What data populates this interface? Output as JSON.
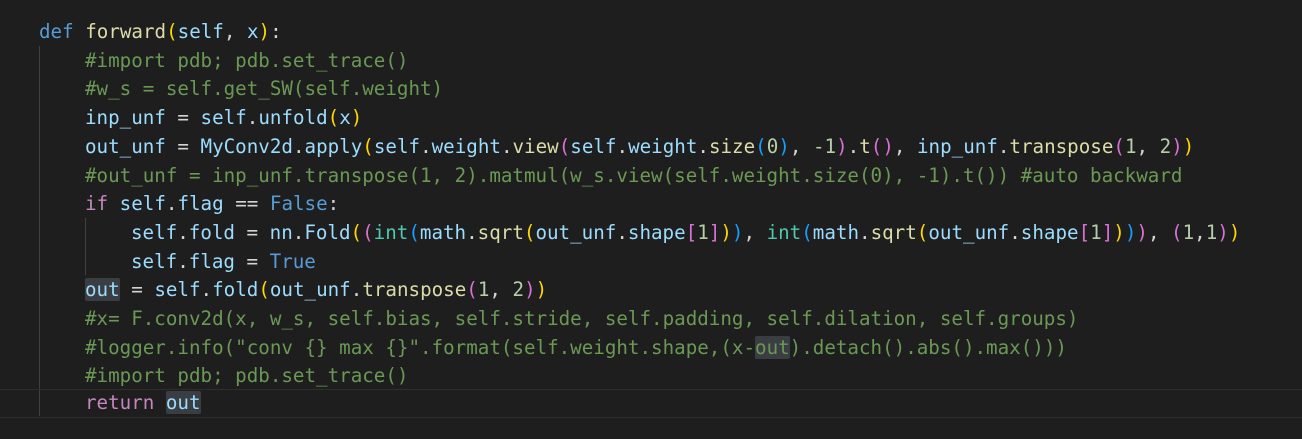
{
  "editor": {
    "language": "python",
    "lines": [
      [
        {
          "t": "def",
          "c": "kw"
        },
        {
          "t": " "
        },
        {
          "t": "forward",
          "c": "fn"
        },
        {
          "t": "(",
          "c": "b1"
        },
        {
          "t": "self",
          "c": "var"
        },
        {
          "t": ", "
        },
        {
          "t": "x",
          "c": "var"
        },
        {
          "t": ")",
          "c": "b1"
        },
        {
          "t": ":"
        }
      ],
      [
        {
          "t": "#import pdb; pdb.set_trace()",
          "c": "cmt"
        }
      ],
      [
        {
          "t": "#w_s = self.get_SW(self.weight)",
          "c": "cmt"
        }
      ],
      [
        {
          "t": "inp_unf",
          "c": "var"
        },
        {
          "t": " = "
        },
        {
          "t": "self",
          "c": "var"
        },
        {
          "t": "."
        },
        {
          "t": "unfold",
          "c": "var"
        },
        {
          "t": "(",
          "c": "b1"
        },
        {
          "t": "x",
          "c": "var"
        },
        {
          "t": ")",
          "c": "b1"
        }
      ],
      [
        {
          "t": "out_unf",
          "c": "var"
        },
        {
          "t": " = "
        },
        {
          "t": "MyConv2d",
          "c": "var"
        },
        {
          "t": "."
        },
        {
          "t": "apply",
          "c": "var"
        },
        {
          "t": "(",
          "c": "b1"
        },
        {
          "t": "self",
          "c": "var"
        },
        {
          "t": "."
        },
        {
          "t": "weight",
          "c": "var"
        },
        {
          "t": "."
        },
        {
          "t": "view",
          "c": "fn"
        },
        {
          "t": "(",
          "c": "b2"
        },
        {
          "t": "self",
          "c": "var"
        },
        {
          "t": "."
        },
        {
          "t": "weight",
          "c": "var"
        },
        {
          "t": "."
        },
        {
          "t": "size",
          "c": "fn"
        },
        {
          "t": "(",
          "c": "b3"
        },
        {
          "t": "0",
          "c": "num"
        },
        {
          "t": ")",
          "c": "b3"
        },
        {
          "t": ", "
        },
        {
          "t": "-1",
          "c": "num"
        },
        {
          "t": ")",
          "c": "b2"
        },
        {
          "t": "."
        },
        {
          "t": "t",
          "c": "fn"
        },
        {
          "t": "(",
          "c": "b2"
        },
        {
          "t": ")",
          "c": "b2"
        },
        {
          "t": ", "
        },
        {
          "t": "inp_unf",
          "c": "var"
        },
        {
          "t": "."
        },
        {
          "t": "transpose",
          "c": "fn"
        },
        {
          "t": "(",
          "c": "b2"
        },
        {
          "t": "1",
          "c": "num"
        },
        {
          "t": ", "
        },
        {
          "t": "2",
          "c": "num"
        },
        {
          "t": ")",
          "c": "b2"
        },
        {
          "t": ")",
          "c": "b1"
        }
      ],
      [
        {
          "t": "#out_unf = inp_unf.transpose(1, 2).matmul(w_s.view(self.weight.size(0), -1).t()) #auto backward",
          "c": "cmt"
        }
      ],
      [
        {
          "t": "if",
          "c": "ctl"
        },
        {
          "t": " "
        },
        {
          "t": "self",
          "c": "var"
        },
        {
          "t": "."
        },
        {
          "t": "flag",
          "c": "var"
        },
        {
          "t": " == "
        },
        {
          "t": "False",
          "c": "kw"
        },
        {
          "t": ":"
        }
      ],
      [
        {
          "t": "self",
          "c": "var"
        },
        {
          "t": "."
        },
        {
          "t": "fold",
          "c": "var"
        },
        {
          "t": " = "
        },
        {
          "t": "nn",
          "c": "var"
        },
        {
          "t": "."
        },
        {
          "t": "Fold",
          "c": "var"
        },
        {
          "t": "(",
          "c": "b1"
        },
        {
          "t": "(",
          "c": "b2"
        },
        {
          "t": "int",
          "c": "cls"
        },
        {
          "t": "(",
          "c": "b3"
        },
        {
          "t": "math",
          "c": "var"
        },
        {
          "t": "."
        },
        {
          "t": "sqrt",
          "c": "fn"
        },
        {
          "t": "(",
          "c": "b1"
        },
        {
          "t": "out_unf",
          "c": "var"
        },
        {
          "t": "."
        },
        {
          "t": "shape",
          "c": "var"
        },
        {
          "t": "[",
          "c": "b2"
        },
        {
          "t": "1",
          "c": "num"
        },
        {
          "t": "]",
          "c": "b2"
        },
        {
          "t": ")",
          "c": "b1"
        },
        {
          "t": ")",
          "c": "b3"
        },
        {
          "t": ", "
        },
        {
          "t": "int",
          "c": "cls"
        },
        {
          "t": "(",
          "c": "b3"
        },
        {
          "t": "math",
          "c": "var"
        },
        {
          "t": "."
        },
        {
          "t": "sqrt",
          "c": "fn"
        },
        {
          "t": "(",
          "c": "b1"
        },
        {
          "t": "out_unf",
          "c": "var"
        },
        {
          "t": "."
        },
        {
          "t": "shape",
          "c": "var"
        },
        {
          "t": "[",
          "c": "b2"
        },
        {
          "t": "1",
          "c": "num"
        },
        {
          "t": "]",
          "c": "b2"
        },
        {
          "t": ")",
          "c": "b1"
        },
        {
          "t": ")",
          "c": "b3"
        },
        {
          "t": ")",
          "c": "b2"
        },
        {
          "t": ", "
        },
        {
          "t": "(",
          "c": "b2"
        },
        {
          "t": "1",
          "c": "num"
        },
        {
          "t": ","
        },
        {
          "t": "1",
          "c": "num"
        },
        {
          "t": ")",
          "c": "b2"
        },
        {
          "t": ")",
          "c": "b1"
        }
      ],
      [
        {
          "t": "self",
          "c": "var"
        },
        {
          "t": "."
        },
        {
          "t": "flag",
          "c": "var"
        },
        {
          "t": " = "
        },
        {
          "t": "True",
          "c": "kw"
        }
      ],
      [
        {
          "t": "out",
          "c": "var",
          "hl": true
        },
        {
          "t": " = "
        },
        {
          "t": "self",
          "c": "var"
        },
        {
          "t": "."
        },
        {
          "t": "fold",
          "c": "var"
        },
        {
          "t": "(",
          "c": "b1"
        },
        {
          "t": "out_unf",
          "c": "var"
        },
        {
          "t": "."
        },
        {
          "t": "transpose",
          "c": "fn"
        },
        {
          "t": "(",
          "c": "b2"
        },
        {
          "t": "1",
          "c": "num"
        },
        {
          "t": ", "
        },
        {
          "t": "2",
          "c": "num"
        },
        {
          "t": ")",
          "c": "b2"
        },
        {
          "t": ")",
          "c": "b1"
        }
      ],
      [
        {
          "t": "#x= F.conv2d(x, w_s, self.bias, self.stride, self.padding, self.dilation, self.groups)",
          "c": "cmt"
        }
      ],
      [
        {
          "t": "#logger.info(\"conv {} max {}\".format(self.weight.shape,(x-",
          "c": "cmt"
        },
        {
          "t": "out",
          "c": "cmt",
          "hl": true
        },
        {
          "t": ").detach().abs().max()))",
          "c": "cmt"
        }
      ],
      [
        {
          "t": "#import pdb; pdb.set_trace()",
          "c": "cmt"
        }
      ],
      [
        {
          "t": "return",
          "c": "ctl"
        },
        {
          "t": " "
        },
        {
          "t": "out",
          "c": "var",
          "hl": true
        }
      ]
    ]
  }
}
